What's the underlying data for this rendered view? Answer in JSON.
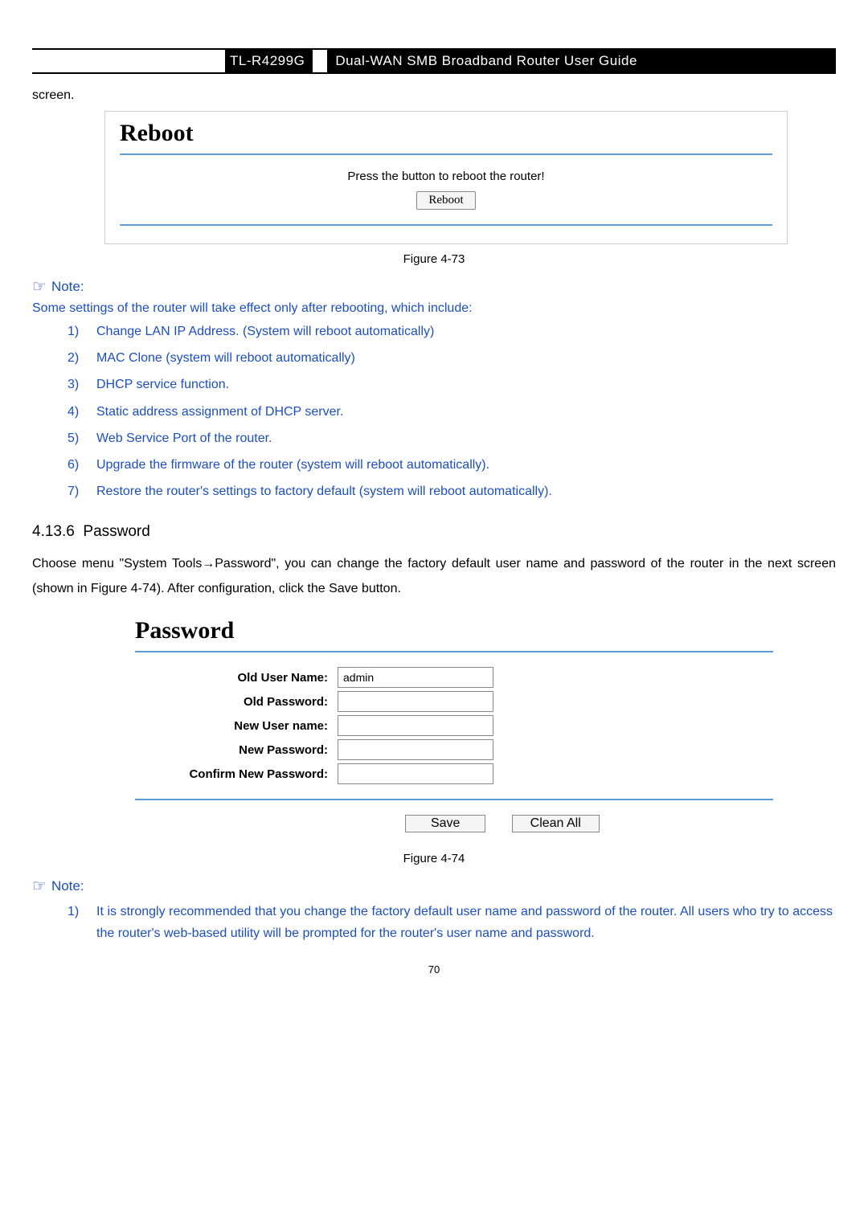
{
  "header": {
    "model": "TL-R4299G",
    "title": "Dual-WAN SMB Broadband Router User Guide"
  },
  "intro": {
    "continuation": "screen."
  },
  "reboot_panel": {
    "title": "Reboot",
    "instruction": "Press the button to reboot the router!",
    "button": "Reboot"
  },
  "fig73_caption": "Figure 4-73",
  "note1": {
    "label": "Note:",
    "lead": "Some settings of the router will take effect only after rebooting, which include:",
    "items": [
      "Change LAN IP Address. (System will reboot automatically)",
      "MAC Clone (system will reboot automatically)",
      "DHCP service function.",
      "Static address assignment of DHCP server.",
      "Web Service Port of the router.",
      "Upgrade the firmware of the router (system will reboot automatically).",
      "Restore the router's settings to factory default (system will reboot automatically)."
    ]
  },
  "section": {
    "number": "4.13.6",
    "title": "Password"
  },
  "password_intro": "Choose menu \"System Tools→Password\", you can change the factory default user name and password of the router in the next screen (shown in Figure 4-74). After configuration, click the Save button.",
  "password_panel": {
    "title": "Password",
    "fields": {
      "old_user_label": "Old User Name:",
      "old_user_value": "admin",
      "old_pass_label": "Old Password:",
      "new_user_label": "New User name:",
      "new_pass_label": "New Password:",
      "confirm_label": "Confirm New Password:"
    },
    "save_button": "Save",
    "clean_button": "Clean All"
  },
  "fig74_caption": "Figure 4-74",
  "note2": {
    "label": "Note:",
    "items": [
      "It is strongly recommended that you change the factory default user name and password of the router. All users who try to access the router's web-based utility will be prompted for the router's user name and password."
    ]
  },
  "page_number": "70"
}
